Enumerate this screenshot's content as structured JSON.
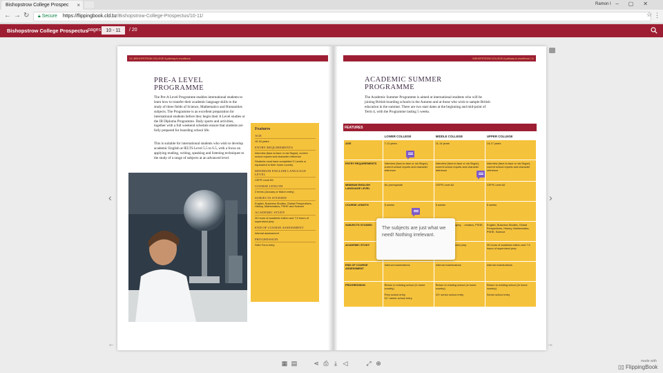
{
  "browser": {
    "tab_title": "Bishopstrow College Prospec",
    "user_name": "Ramon I",
    "security_label": "Secure",
    "url_host": "https://flippingbook.cld.bz",
    "url_path": "/Bishopstrow-College-Prospectus/10-11/"
  },
  "app": {
    "title": "Bishopstrow College Prospectus",
    "pages_label": "pages:",
    "current_pages": "10 - 11",
    "total_pages": "/  20"
  },
  "left_page": {
    "running_head": "10  |  BISHOPSTROW COLLEGE A pathway to excellence",
    "title_line1": "PRE-A LEVEL",
    "title_line2": "PROGRAMME",
    "para1": "The Pre-A Level Programme enables international students to learn how to transfer their academic language skills to the study of three fields of Science, Mathematics and Humanities subjects. The Programme is an excellent preparation for international students before they begin their A Level studies or the IB Diploma Programme. Daily sports and activities, together with a full weekend schedule ensure that students are fully prepared for boarding school life.",
    "para2": "This is suitable for international students who wish to develop academic English at IELTS Level 5.5 to 6.5, with a focus on applying reading, writing, speaking and listening techniques to the study of a range of subjects at an advanced level.",
    "features": {
      "title": "Features",
      "items": [
        {
          "label": "AGE",
          "value": "15-16 years"
        },
        {
          "label": "ENTRY REQUIREMENTS",
          "value": "Interview (face-to-face or via Skype), current school reports and character reference"
        },
        {
          "label": "",
          "value": "Students must have completed O Levels or equivalent in their home country"
        },
        {
          "label": "MINIMUM ENGLISH LANGUAGE LEVEL",
          "value": "CEFR Level B2"
        },
        {
          "label": "COURSE LENGTH",
          "value": "2 terms (January or March entry)"
        },
        {
          "label": "SUBJECTS STUDIED",
          "value": "English, Business Studies, Global Perspectives, History, Mathematics, PSHE and Science"
        },
        {
          "label": "ACADEMIC STUDY",
          "value": "30 hours of academic tuition and 7.5 hours of supervised prep"
        },
        {
          "label": "END OF COURSE ASSESSMENT",
          "value": "Internal assessment"
        },
        {
          "label": "PROGRESSION",
          "value": "Sixth Form entry"
        }
      ]
    }
  },
  "right_page": {
    "running_head": "BISHOPSTROW COLLEGE A pathway to excellence  |  11",
    "title_line1": "ACADEMIC SUMMER",
    "title_line2": "PROGRAMME",
    "para1": "The Academic Summer Programme is aimed at international students who will be joining British boarding schools in the Autumn and at those who wish to sample British education in the summer. There are two start dates at the beginning and mid-point of Term 4, with the Programme lasting 5 weeks.",
    "features_label": "FEATURES",
    "columns": [
      "",
      "LOWER COLLEGE",
      "MIDDLE COLLEGE",
      "UPPER COLLEGE"
    ],
    "rows": [
      {
        "label": "AGE",
        "cells": [
          "7-11 years",
          "11-14 years",
          "14-17 years"
        ]
      },
      {
        "label": "ENTRY REQUIREMENTS",
        "cells": [
          "Interview (face-to-face or via Skype), current school reports and character reference",
          "Interview (face-to-face or via Skype), current school reports and character reference",
          "Interview (face-to-face or via Skype), current school reports and character reference"
        ]
      },
      {
        "label": "MINIMUM ENGLISH LANGUAGE LEVEL",
        "cells": [
          "No prerequisite",
          "CEFR Level A2",
          "CEFR Level A2"
        ]
      },
      {
        "label": "COURSE LENGTH",
        "cells": [
          "5 weeks",
          "5 weeks",
          "5 weeks"
        ]
      },
      {
        "label": "SUBJECTS STUDIED",
        "cells": [
          "",
          "...on Arts, Geography, ...ematics, PSHE, ...",
          "English, Business Studies, Global Perspectives, History, Mathematics, PSHE, Science"
        ]
      },
      {
        "label": "ACADEMIC STUDY",
        "cells": [
          "",
          "...c tuition and ...ised prep",
          "30 hours of academic tuition and 7.5 hours of supervised prep"
        ]
      },
      {
        "label": "END OF COURSE ASSESSMENT",
        "cells": [
          "Internal examinations",
          "Internal examinations",
          "Internal examinations"
        ]
      },
      {
        "label": "PROGRESSION",
        "cells": [
          "Return to existing school (in home country)\n\nPrep school entry\n11+ senior school entry",
          "Return to existing school (in home country)\n\n13+ senior school entry",
          "Return to existing school (in home country)\n\nSenior school entry"
        ]
      }
    ]
  },
  "comment_popup": {
    "text": "The subjects are just what we need! Nothing irrelevant."
  },
  "footer": {
    "made_with": "made with",
    "brand": "FlippingBook"
  },
  "colors": {
    "brand_red": "#9d1e32",
    "feature_yellow": "#f5c23c",
    "comment_purple": "#7e5bc7"
  }
}
